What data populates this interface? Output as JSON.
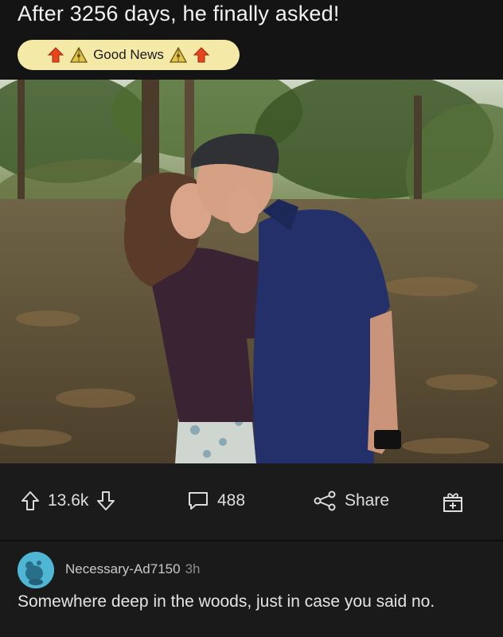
{
  "post": {
    "title": "After 3256 days, he finally asked!",
    "flair": {
      "label": "Good News",
      "bg_color": "#f4e9a6",
      "left_icons": [
        "upvote-arrow-icon",
        "pyramid-icon"
      ],
      "right_icons": [
        "pyramid-icon",
        "upvote-arrow-icon"
      ]
    },
    "image": {
      "content": "couple-kissing-in-forest-photo"
    }
  },
  "actions": {
    "upvote_icon": "upvote-arrow-icon",
    "vote_count": "13.6k",
    "downvote_icon": "downvote-arrow-icon",
    "comment_icon": "comment-bubble-icon",
    "comment_count": "488",
    "share_icon": "share-icon",
    "share_label": "Share",
    "award_icon": "gift-award-icon"
  },
  "comment": {
    "author": "Necessary-Ad7150",
    "age": "3h",
    "text": "Somewhere deep in the woods, just in case you said no.",
    "avatar_color": "#4fb7d4"
  }
}
